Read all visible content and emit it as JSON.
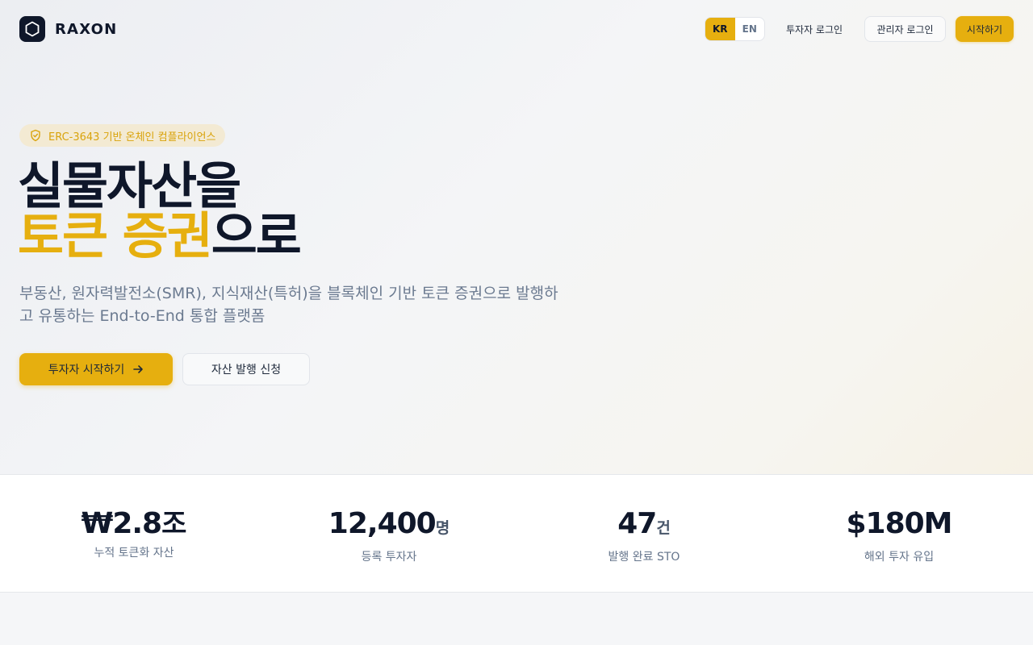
{
  "brand": {
    "name": "RAXON"
  },
  "header": {
    "lang": [
      "KR",
      "EN"
    ],
    "investor_login": "투자자 로그인",
    "admin_login": "관리자 로그인",
    "start": "시작하기"
  },
  "hero": {
    "badge": "ERC-3643 기반 온체인 컴플라이언스",
    "headline_line1": "실물자산을",
    "headline_accent": "토큰 증권",
    "headline_suffix": "으로",
    "subtitle": "부동산, 원자력발전소(SMR), 지식재산(특허)을 블록체인 기반 토큰 증권으로 발행하고 유통하는 End-to-End 통합 플랫폼",
    "cta_primary": "투자자 시작하기",
    "cta_secondary": "자산 발행 신청"
  },
  "stats": [
    {
      "value": "₩2.8",
      "unit": "조",
      "label": "누적 토큰화 자산"
    },
    {
      "value": "12,400",
      "unit": "명",
      "label": "등록 투자자"
    },
    {
      "value": "47",
      "unit": "건",
      "label": "발행 완료 STO"
    },
    {
      "value": "$180M",
      "unit": "",
      "label": "해외 투자 유입"
    }
  ],
  "colors": {
    "accent": "#e6af0f",
    "dark": "#0f172a",
    "muted": "#64748b"
  },
  "icons": {
    "logo": "hexagon-icon",
    "badge": "shield-check-icon",
    "cta": "arrow-right-icon"
  }
}
